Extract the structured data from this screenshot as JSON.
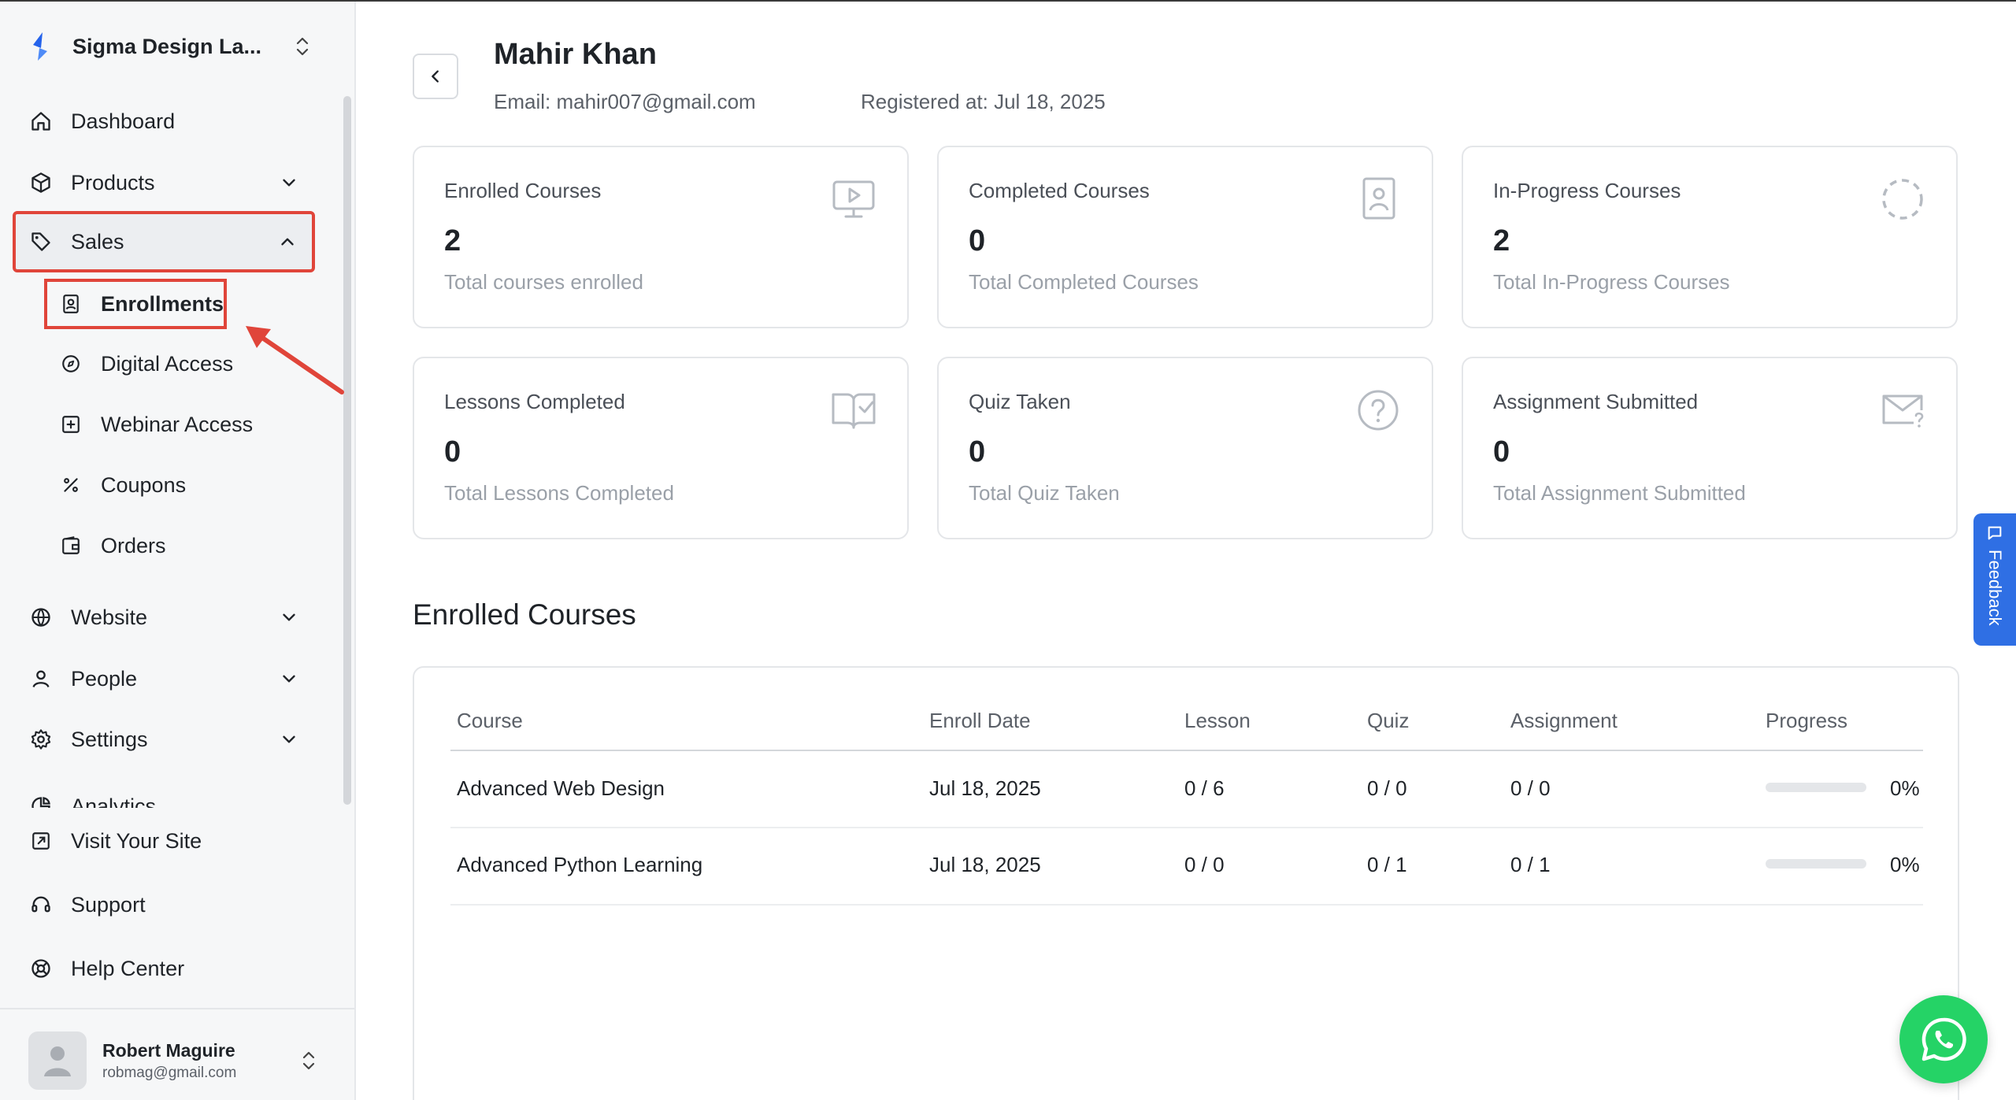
{
  "sidebar": {
    "workspace_name": "Sigma Design La...",
    "nav": {
      "dashboard": "Dashboard",
      "products": "Products",
      "sales": "Sales",
      "website": "Website",
      "people": "People",
      "settings": "Settings",
      "analytics": "Analytics"
    },
    "sales_sub": {
      "enrollments": "Enrollments",
      "digital_access": "Digital Access",
      "webinar_access": "Webinar Access",
      "coupons": "Coupons",
      "orders": "Orders"
    },
    "footer_links": {
      "visit_site": "Visit Your Site",
      "support": "Support",
      "help_center": "Help Center"
    },
    "user": {
      "name": "Robert Maguire",
      "email": "robmag@gmail.com"
    }
  },
  "profile": {
    "name": "Mahir Khan",
    "email_line": "Email: mahir007@gmail.com",
    "registered_line": "Registered at: Jul 18, 2025"
  },
  "stats": [
    {
      "title": "Enrolled Courses",
      "value": "2",
      "subtitle": "Total courses enrolled",
      "icon": "monitor-play-icon"
    },
    {
      "title": "Completed Courses",
      "value": "0",
      "subtitle": "Total Completed Courses",
      "icon": "user-badge-icon"
    },
    {
      "title": "In-Progress Courses",
      "value": "2",
      "subtitle": "Total In-Progress Courses",
      "icon": "dashed-circle-icon"
    },
    {
      "title": "Lessons Completed",
      "value": "0",
      "subtitle": "Total Lessons Completed",
      "icon": "book-check-icon"
    },
    {
      "title": "Quiz Taken",
      "value": "0",
      "subtitle": "Total Quiz Taken",
      "icon": "question-circle-icon"
    },
    {
      "title": "Assignment Submitted",
      "value": "0",
      "subtitle": "Total Assignment Submitted",
      "icon": "mail-question-icon"
    }
  ],
  "enrolled_section": {
    "title": "Enrolled Courses",
    "columns": [
      "Course",
      "Enroll Date",
      "Lesson",
      "Quiz",
      "Assignment",
      "Progress"
    ],
    "rows": [
      {
        "course": "Advanced Web Design",
        "enroll_date": "Jul 18, 2025",
        "lesson": "0 / 6",
        "quiz": "0 / 0",
        "assignment": "0 / 0",
        "progress": 0,
        "progress_label": "0%"
      },
      {
        "course": "Advanced Python Learning",
        "enroll_date": "Jul 18, 2025",
        "lesson": "0 / 0",
        "quiz": "0 / 1",
        "assignment": "0 / 1",
        "progress": 0,
        "progress_label": "0%"
      }
    ]
  },
  "feedback_label": "Feedback",
  "colors": {
    "highlight": "#e0453a",
    "feedback": "#2f6fe4",
    "whatsapp": "#25d366",
    "brand": "#2563eb"
  }
}
